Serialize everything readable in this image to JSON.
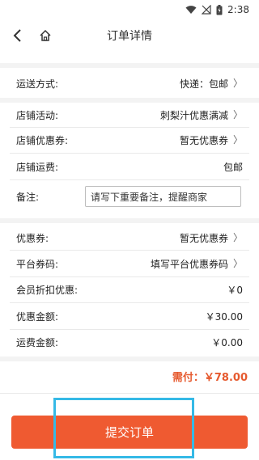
{
  "status_bar": {
    "time": "2:38"
  },
  "header": {
    "title": "订单详情"
  },
  "shipping": {
    "label": "运送方式:",
    "value": "快递：包邮"
  },
  "shop": [
    {
      "label": "店铺活动:",
      "value": "刺梨汁优惠满减"
    },
    {
      "label": "店铺优惠券:",
      "value": "暂无优惠券"
    },
    {
      "label": "店铺运费:",
      "value": "包邮"
    }
  ],
  "note": {
    "label": "备注:",
    "placeholder": "请写下重要备注，提醒商家"
  },
  "discounts": [
    {
      "label": "优惠券:",
      "value": "暂无优惠券"
    },
    {
      "label": "平台券码:",
      "value": "填写平台优惠券码"
    },
    {
      "label": "会员折扣优惠:",
      "value": "￥0"
    },
    {
      "label": "优惠金额:",
      "value": "￥30.00"
    },
    {
      "label": "运费金额:",
      "value": "￥0.00"
    }
  ],
  "total": {
    "text": "需付：￥78.00"
  },
  "submit": {
    "label": "提交订单"
  },
  "colors": {
    "accent": "#ef5a31",
    "price": "#e65a2f",
    "highlight": "#35b9e6"
  }
}
